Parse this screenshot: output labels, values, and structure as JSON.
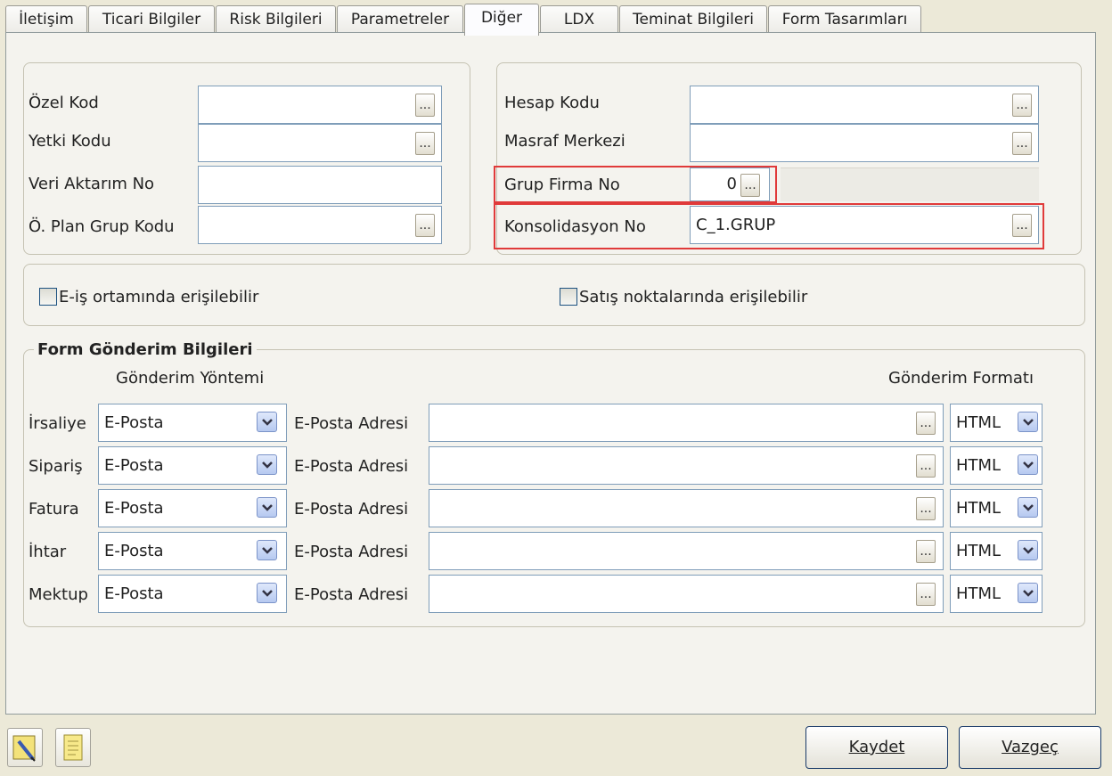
{
  "tabs": [
    {
      "label": "İletişim"
    },
    {
      "label": "Ticari Bilgiler"
    },
    {
      "label": "Risk Bilgileri"
    },
    {
      "label": "Parametreler"
    },
    {
      "label": "Diğer"
    },
    {
      "label": "LDX"
    },
    {
      "label": "Teminat Bilgileri"
    },
    {
      "label": "Form Tasarımları"
    }
  ],
  "active_tab": "Diğer",
  "left_fields": [
    {
      "label": "Özel Kod",
      "value": "",
      "has_lookup": true
    },
    {
      "label": "Yetki Kodu",
      "value": "",
      "has_lookup": true
    },
    {
      "label": "Veri Aktarım No",
      "value": "",
      "has_lookup": false
    },
    {
      "label": "Ö. Plan Grup Kodu",
      "value": "",
      "has_lookup": true
    }
  ],
  "right_fields": [
    {
      "label": "Hesap Kodu",
      "value": ""
    },
    {
      "label": "Masraf Merkezi",
      "value": ""
    },
    {
      "label": "Grup Firma No",
      "value": "0"
    },
    {
      "label": "Konsolidasyon No",
      "value": "C_1.GRUP"
    }
  ],
  "checkboxes": [
    {
      "label": "E-iş ortamında erişilebilir",
      "checked": false
    },
    {
      "label": "Satış noktalarında erişilebilir",
      "checked": false
    }
  ],
  "form_sending": {
    "title": "Form Gönderim Bilgileri",
    "method_header": "Gönderim Yöntemi",
    "format_header": "Gönderim Formatı",
    "rows": [
      {
        "doc": "İrsaliye",
        "method": "E-Posta",
        "addr_label": "E-Posta Adresi",
        "address": "",
        "format": "HTML"
      },
      {
        "doc": "Sipariş",
        "method": "E-Posta",
        "addr_label": "E-Posta Adresi",
        "address": "",
        "format": "HTML"
      },
      {
        "doc": "Fatura",
        "method": "E-Posta",
        "addr_label": "E-Posta Adresi",
        "address": "",
        "format": "HTML"
      },
      {
        "doc": "İhtar",
        "method": "E-Posta",
        "addr_label": "E-Posta Adresi",
        "address": "",
        "format": "HTML"
      },
      {
        "doc": "Mektup",
        "method": "E-Posta",
        "addr_label": "E-Posta Adresi",
        "address": "",
        "format": "HTML"
      }
    ]
  },
  "lookup_glyph": "...",
  "buttons": {
    "save": "Kaydet",
    "cancel": "Vazgeç"
  },
  "colors": {
    "highlight": "#e03a3a",
    "field_border": "#7f9db9",
    "panel_bg": "#f4f3ee"
  }
}
